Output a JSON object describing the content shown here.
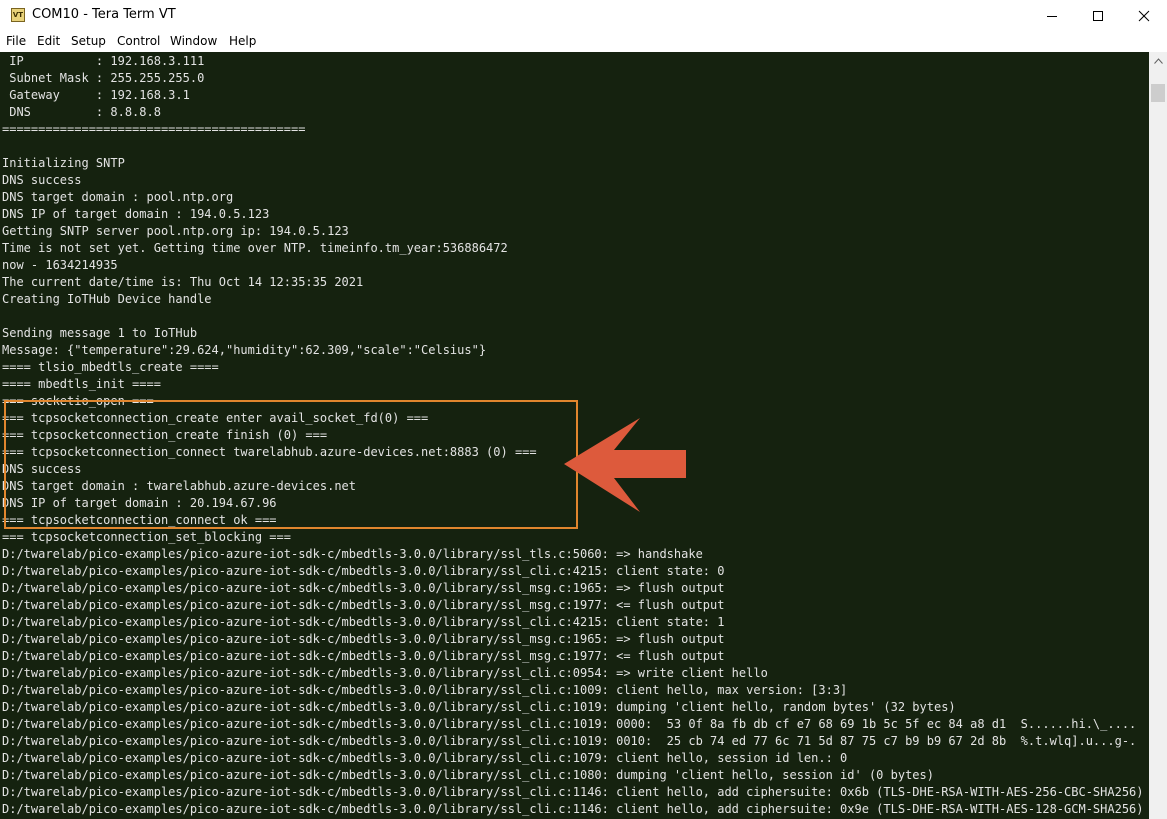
{
  "window": {
    "title": "COM10 - Tera Term VT",
    "icon": "tera-term-icon",
    "icon_label": "VT",
    "controls": [
      "minimize-icon",
      "maximize-icon",
      "close-icon"
    ]
  },
  "menu": {
    "items": [
      {
        "label": "File"
      },
      {
        "label": "Edit"
      },
      {
        "label": "Setup"
      },
      {
        "label": "Control"
      },
      {
        "label": "Window"
      },
      {
        "label": "Help"
      }
    ]
  },
  "terminal": {
    "background": "#15220f",
    "text_color": "#e3e3e3",
    "lines": [
      " IP          : 192.168.3.111",
      " Subnet Mask : 255.255.255.0",
      " Gateway     : 192.168.3.1",
      " DNS         : 8.8.8.8",
      "==========================================",
      "",
      "Initializing SNTP",
      "DNS success",
      "DNS target domain : pool.ntp.org",
      "DNS IP of target domain : 194.0.5.123",
      "Getting SNTP server pool.ntp.org ip: 194.0.5.123",
      "Time is not set yet. Getting time over NTP. timeinfo.tm_year:536886472",
      "now - 1634214935",
      "The current date/time is: Thu Oct 14 12:35:35 2021",
      "Creating IoTHub Device handle",
      "",
      "Sending message 1 to IoTHub",
      "Message: {\"temperature\":29.624,\"humidity\":62.309,\"scale\":\"Celsius\"}",
      "==== tlsio_mbedtls_create ====",
      "==== mbedtls_init ====",
      "=== socketio_open ===",
      "=== tcpsocketconnection_create enter avail_socket_fd(0) ===",
      "=== tcpsocketconnection_create finish (0) ===",
      "=== tcpsocketconnection_connect twarelabhub.azure-devices.net:8883 (0) ===",
      "DNS success",
      "DNS target domain : twarelabhub.azure-devices.net",
      "DNS IP of target domain : 20.194.67.96",
      "=== tcpsocketconnection_connect ok ===",
      "=== tcpsocketconnection_set_blocking ===",
      "D:/twarelab/pico-examples/pico-azure-iot-sdk-c/mbedtls-3.0.0/library/ssl_tls.c:5060: => handshake",
      "D:/twarelab/pico-examples/pico-azure-iot-sdk-c/mbedtls-3.0.0/library/ssl_cli.c:4215: client state: 0",
      "D:/twarelab/pico-examples/pico-azure-iot-sdk-c/mbedtls-3.0.0/library/ssl_msg.c:1965: => flush output",
      "D:/twarelab/pico-examples/pico-azure-iot-sdk-c/mbedtls-3.0.0/library/ssl_msg.c:1977: <= flush output",
      "D:/twarelab/pico-examples/pico-azure-iot-sdk-c/mbedtls-3.0.0/library/ssl_cli.c:4215: client state: 1",
      "D:/twarelab/pico-examples/pico-azure-iot-sdk-c/mbedtls-3.0.0/library/ssl_msg.c:1965: => flush output",
      "D:/twarelab/pico-examples/pico-azure-iot-sdk-c/mbedtls-3.0.0/library/ssl_msg.c:1977: <= flush output",
      "D:/twarelab/pico-examples/pico-azure-iot-sdk-c/mbedtls-3.0.0/library/ssl_cli.c:0954: => write client hello",
      "D:/twarelab/pico-examples/pico-azure-iot-sdk-c/mbedtls-3.0.0/library/ssl_cli.c:1009: client hello, max version: [3:3]",
      "D:/twarelab/pico-examples/pico-azure-iot-sdk-c/mbedtls-3.0.0/library/ssl_cli.c:1019: dumping 'client hello, random bytes' (32 bytes)",
      "D:/twarelab/pico-examples/pico-azure-iot-sdk-c/mbedtls-3.0.0/library/ssl_cli.c:1019: 0000:  53 0f 8a fb db cf e7 68 69 1b 5c 5f ec 84 a8 d1  S......hi.\\_....",
      "D:/twarelab/pico-examples/pico-azure-iot-sdk-c/mbedtls-3.0.0/library/ssl_cli.c:1019: 0010:  25 cb 74 ed 77 6c 71 5d 87 75 c7 b9 b9 67 2d 8b  %.t.wlq].u...g-.",
      "D:/twarelab/pico-examples/pico-azure-iot-sdk-c/mbedtls-3.0.0/library/ssl_cli.c:1079: client hello, session id len.: 0",
      "D:/twarelab/pico-examples/pico-azure-iot-sdk-c/mbedtls-3.0.0/library/ssl_cli.c:1080: dumping 'client hello, session id' (0 bytes)",
      "D:/twarelab/pico-examples/pico-azure-iot-sdk-c/mbedtls-3.0.0/library/ssl_cli.c:1146: client hello, add ciphersuite: 0x6b (TLS-DHE-RSA-WITH-AES-256-CBC-SHA256)",
      "D:/twarelab/pico-examples/pico-azure-iot-sdk-c/mbedtls-3.0.0/library/ssl_cli.c:1146: client hello, add ciphersuite: 0x9e (TLS-DHE-RSA-WITH-AES-128-GCM-SHA256)"
    ]
  },
  "annotation": {
    "box_color": "#e0862e",
    "arrow_color": "#dd5a3c",
    "arrow_icon": "left-arrow-icon"
  }
}
